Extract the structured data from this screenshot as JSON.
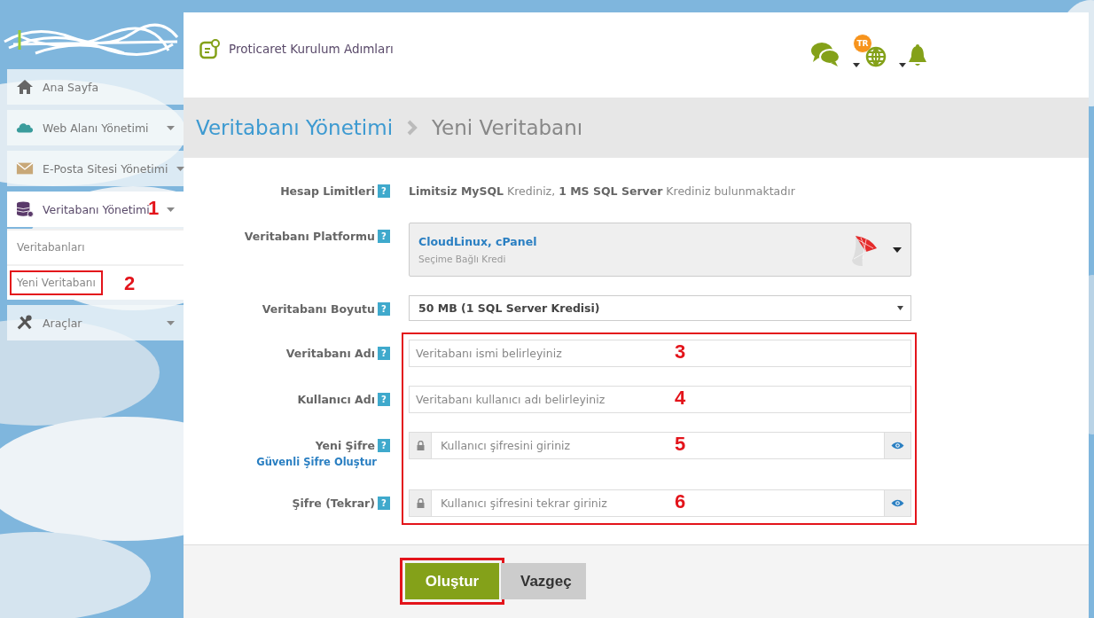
{
  "header": {
    "title": "Proticaret Kurulum Adımları",
    "language_badge": "TR"
  },
  "sidebar": {
    "items": [
      {
        "label": "Ana Sayfa",
        "has_caret": false,
        "expanded": false
      },
      {
        "label": "Web Alanı Yönetimi",
        "has_caret": true,
        "expanded": false
      },
      {
        "label": "E-Posta Sitesi Yönetimi",
        "has_caret": true,
        "expanded": false
      },
      {
        "label": "Veritabanı Yönetimi",
        "has_caret": true,
        "expanded": true,
        "annotation": "1",
        "children": [
          {
            "label": "Veritabanları",
            "marked": false
          },
          {
            "label": "Yeni Veritabanı",
            "marked": true,
            "annotation": "2"
          }
        ]
      },
      {
        "label": "Araçlar",
        "has_caret": true,
        "expanded": false
      }
    ]
  },
  "breadcrumb": [
    "Veritabanı Yönetimi",
    "Yeni Veritabanı"
  ],
  "form": {
    "rows": [
      {
        "kind": "info",
        "label": "Hesap Limitleri",
        "help": "?",
        "value": "**Limitsiz MySQL** Krediniz, **1 MS SQL Server** Krediniz bulunmaktadır"
      },
      {
        "kind": "platform",
        "label": "Veritabanı Platformu",
        "help": "?",
        "title": "CloudLinux, cPanel",
        "subtitle": "Seçime Bağlı Kredi"
      },
      {
        "kind": "select",
        "label": "Veritabanı Boyutu",
        "help": "?",
        "value": "50 MB (1 SQL Server Kredisi)"
      }
    ],
    "marked_rows": [
      {
        "kind": "input",
        "label": "Veritabanı Adı",
        "help": "?",
        "placeholder": "Veritabanı ismi belirleyiniz",
        "annotation": "3"
      },
      {
        "kind": "input",
        "label": "Kullanıcı Adı",
        "help": "?",
        "placeholder": "Veritabanı kullanıcı adı belirleyiniz",
        "annotation": "4"
      },
      {
        "kind": "password",
        "label": "Yeni Şifre",
        "help": "?",
        "link": "Güvenli Şifre Oluştur",
        "placeholder": "Kullanıcı şifresini giriniz",
        "annotation": "5"
      },
      {
        "kind": "password",
        "label": "Şifre (Tekrar)",
        "help": "?",
        "placeholder": "Kullanıcı şifresini tekrar giriniz",
        "annotation": "6"
      }
    ]
  },
  "buttons": [
    {
      "label": "Oluştur",
      "kind": "primary",
      "marked": true
    },
    {
      "label": "Vazgeç",
      "kind": "secondary",
      "marked": false
    }
  ]
}
